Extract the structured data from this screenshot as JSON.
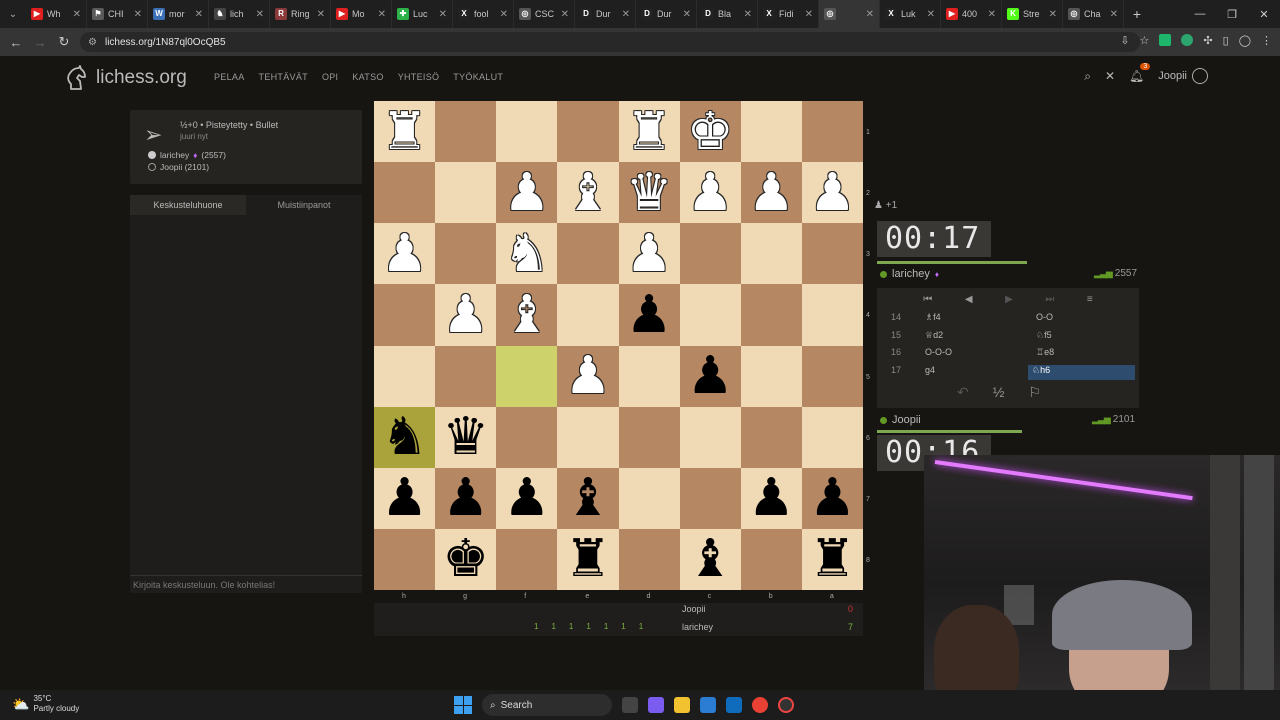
{
  "browser": {
    "tabs": [
      {
        "label": "Wh",
        "fav": "▶",
        "color": "#e02020"
      },
      {
        "label": "CHI",
        "fav": "⚑",
        "color": "#5a5a5a"
      },
      {
        "label": "mor",
        "fav": "W",
        "color": "#3b6fb6"
      },
      {
        "label": "lich",
        "fav": "♞",
        "color": "#444"
      },
      {
        "label": "Ring",
        "fav": "R",
        "color": "#8a3a3a"
      },
      {
        "label": "Mo",
        "fav": "▶",
        "color": "#e02020"
      },
      {
        "label": "Luc",
        "fav": "✚",
        "color": "#2bb34a"
      },
      {
        "label": "fool",
        "fav": "X",
        "color": "#222"
      },
      {
        "label": "CSC",
        "fav": "◎",
        "color": "#555"
      },
      {
        "label": "Dur",
        "fav": "D",
        "color": "#222"
      },
      {
        "label": "Dur",
        "fav": "D",
        "color": "#222"
      },
      {
        "label": "Bla",
        "fav": "D",
        "color": "#222"
      },
      {
        "label": "Fidi",
        "fav": "X",
        "color": "#222"
      },
      {
        "label": "",
        "fav": "◎",
        "color": "#555",
        "active": true
      },
      {
        "label": "Luk",
        "fav": "X",
        "color": "#222"
      },
      {
        "label": "400",
        "fav": "▶",
        "color": "#e02020"
      },
      {
        "label": "Stre",
        "fav": "K",
        "color": "#53fc18"
      },
      {
        "label": "Cha",
        "fav": "◎",
        "color": "#555"
      }
    ],
    "url": "lichess.org/1N87ql0OcQB5"
  },
  "header": {
    "logo": "lichess.org",
    "nav": [
      "PELAA",
      "TEHTÄVÄT",
      "OPI",
      "KATSO",
      "YHTEISÖ",
      "TYÖKALUT"
    ],
    "notif_count": "3",
    "username": "Joopii"
  },
  "gameinfo": {
    "title": "½+0 • Pisteytetty • Bullet",
    "sub": "juuri nyt",
    "white_player": "larichey",
    "white_rating": "(2557)",
    "black_player": "Joopii (2101)"
  },
  "chat": {
    "tab1": "Keskusteluhuone",
    "tab2": "Muistiinpanot",
    "placeholder": "Kirjoita keskusteluun. Ole kohtelias!"
  },
  "board": {
    "rank_labels": [
      "1",
      "2",
      "3",
      "4",
      "5",
      "6",
      "7",
      "8"
    ],
    "file_labels": [
      "h",
      "g",
      "f",
      "e",
      "d",
      "c",
      "b",
      "a"
    ],
    "highlight": [
      {
        "r": 4,
        "c": 2
      },
      {
        "r": 5,
        "c": 0
      }
    ],
    "pieces": [
      {
        "r": 0,
        "c": 0,
        "p": "♜",
        "w": true
      },
      {
        "r": 0,
        "c": 4,
        "p": "♜",
        "w": true
      },
      {
        "r": 0,
        "c": 5,
        "p": "♚",
        "w": true
      },
      {
        "r": 1,
        "c": 2,
        "p": "♟",
        "w": true
      },
      {
        "r": 1,
        "c": 3,
        "p": "♝",
        "w": true
      },
      {
        "r": 1,
        "c": 4,
        "p": "♛",
        "w": true
      },
      {
        "r": 1,
        "c": 5,
        "p": "♟",
        "w": true
      },
      {
        "r": 1,
        "c": 6,
        "p": "♟",
        "w": true
      },
      {
        "r": 1,
        "c": 7,
        "p": "♟",
        "w": true
      },
      {
        "r": 2,
        "c": 0,
        "p": "♟",
        "w": true
      },
      {
        "r": 2,
        "c": 2,
        "p": "♞",
        "w": true
      },
      {
        "r": 2,
        "c": 4,
        "p": "♟",
        "w": true
      },
      {
        "r": 3,
        "c": 1,
        "p": "♟",
        "w": true
      },
      {
        "r": 3,
        "c": 2,
        "p": "♝",
        "w": true
      },
      {
        "r": 3,
        "c": 4,
        "p": "♟",
        "w": false
      },
      {
        "r": 4,
        "c": 3,
        "p": "♟",
        "w": true
      },
      {
        "r": 4,
        "c": 5,
        "p": "♟",
        "w": false
      },
      {
        "r": 5,
        "c": 0,
        "p": "♞",
        "w": false
      },
      {
        "r": 5,
        "c": 1,
        "p": "♛",
        "w": false
      },
      {
        "r": 6,
        "c": 0,
        "p": "♟",
        "w": false
      },
      {
        "r": 6,
        "c": 1,
        "p": "♟",
        "w": false
      },
      {
        "r": 6,
        "c": 2,
        "p": "♟",
        "w": false
      },
      {
        "r": 6,
        "c": 3,
        "p": "♝",
        "w": false
      },
      {
        "r": 6,
        "c": 6,
        "p": "♟",
        "w": false
      },
      {
        "r": 6,
        "c": 7,
        "p": "♟",
        "w": false
      },
      {
        "r": 7,
        "c": 1,
        "p": "♚",
        "w": false
      },
      {
        "r": 7,
        "c": 3,
        "p": "♜",
        "w": false
      },
      {
        "r": 7,
        "c": 5,
        "p": "♝",
        "w": false
      },
      {
        "r": 7,
        "c": 7,
        "p": "♜",
        "w": false
      }
    ]
  },
  "material": {
    "top_name": "Joopii",
    "top_score": "0",
    "bottom_name": "larichey",
    "bottom_score": "7",
    "ticks": [
      "1",
      "1",
      "1",
      "1",
      "1",
      "1",
      "1"
    ]
  },
  "right": {
    "captured": "+1",
    "opp_clock": "00:17",
    "opp_name": "larichey",
    "opp_rating": "2557",
    "my_clock": "00:16",
    "my_name": "Joopii",
    "my_rating": "2101",
    "moves": [
      {
        "n": "14",
        "w": "♗f4",
        "b": "O-O"
      },
      {
        "n": "15",
        "w": "♕d2",
        "b": "♘f5"
      },
      {
        "n": "16",
        "w": "O-O-O",
        "b": "♖e8"
      },
      {
        "n": "17",
        "w": "g4",
        "b": "♘h6"
      }
    ],
    "draw_label": "½"
  },
  "taskbar": {
    "temp": "35°C",
    "weather": "Partly cloudy",
    "search": "Search"
  }
}
